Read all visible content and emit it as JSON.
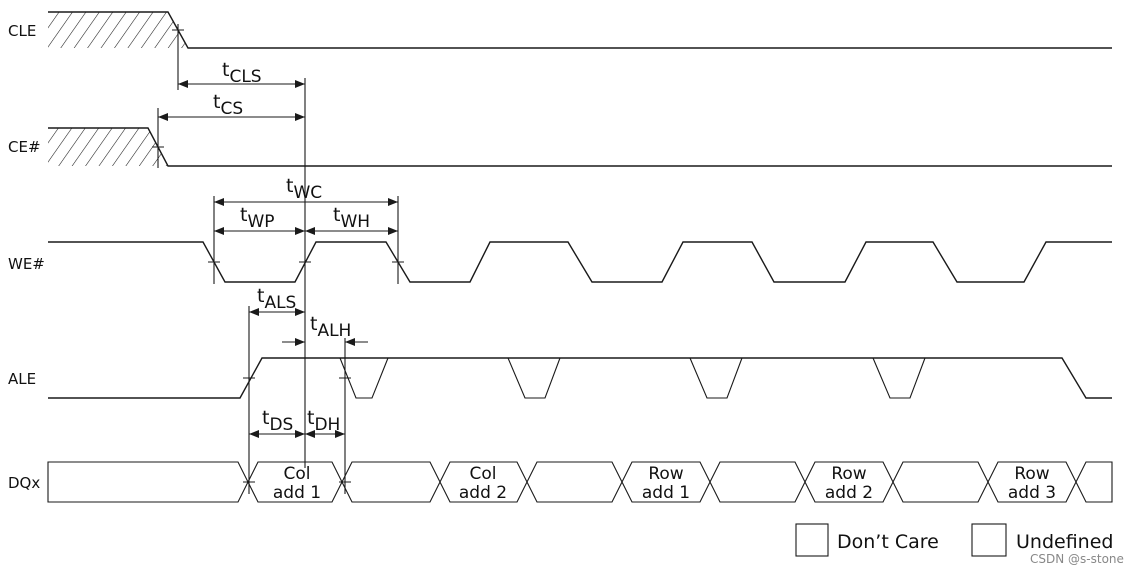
{
  "signals": {
    "cle": "CLE",
    "ce": "CE#",
    "we": "WE#",
    "ale": "ALE",
    "dq": "DQx"
  },
  "timings": {
    "tcls": {
      "t": "t",
      "sub": "CLS"
    },
    "tcs": {
      "t": "t",
      "sub": "CS"
    },
    "twc": {
      "t": "t",
      "sub": "WC"
    },
    "twp": {
      "t": "t",
      "sub": "WP"
    },
    "twh": {
      "t": "t",
      "sub": "WH"
    },
    "tals": {
      "t": "t",
      "sub": "ALS"
    },
    "talh": {
      "t": "t",
      "sub": "ALH"
    },
    "tds": {
      "t": "t",
      "sub": "DS"
    },
    "tdh": {
      "t": "t",
      "sub": "DH"
    }
  },
  "bus_values": [
    {
      "line1": "Col",
      "line2": "add 1"
    },
    {
      "line1": "Col",
      "line2": "add 2"
    },
    {
      "line1": "Row",
      "line2": "add 1"
    },
    {
      "line1": "Row",
      "line2": "add 2"
    },
    {
      "line1": "Row",
      "line2": "add 3"
    }
  ],
  "legend": {
    "dont_care": "Don’t Care",
    "undefined": "Undefined"
  },
  "watermark": "CSDN @s-stone",
  "colors": {
    "bus_fill": "#cfe3e0",
    "line": "#1a1a1a"
  }
}
